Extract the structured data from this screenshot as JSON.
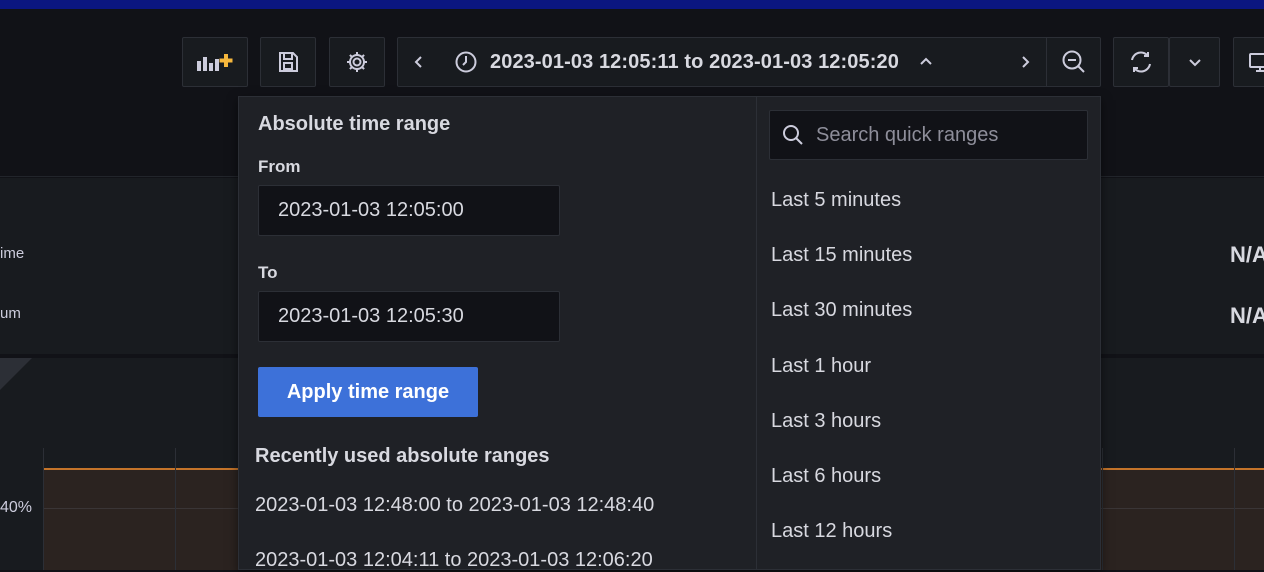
{
  "toolbar": {
    "time_range_text": "2023-01-03 12:05:11 to 2023-01-03 12:05:20",
    "icons": [
      "add-panel-icon",
      "save-icon",
      "gear-icon",
      "chevron-left-icon",
      "clock-icon",
      "chevron-up-icon",
      "chevron-right-icon",
      "zoom-out-icon",
      "refresh-icon",
      "chevron-down-icon",
      "tv-icon"
    ]
  },
  "background": {
    "row_labels": [
      "ime",
      "um"
    ],
    "values": [
      "N/A",
      "N/A"
    ],
    "axis_tick": "40%"
  },
  "picker": {
    "title": "Absolute time range",
    "from_label": "From",
    "from_value": "2023-01-03 12:05:00",
    "to_label": "To",
    "to_value": "2023-01-03 12:05:30",
    "apply_label": "Apply time range",
    "recent_title": "Recently used absolute ranges",
    "recent": [
      "2023-01-03 12:48:00 to 2023-01-03 12:48:40",
      "2023-01-03 12:04:11 to 2023-01-03 12:06:20"
    ],
    "search_placeholder": "Search quick ranges",
    "quick_ranges": [
      "Last 5 minutes",
      "Last 15 minutes",
      "Last 30 minutes",
      "Last 1 hour",
      "Last 3 hours",
      "Last 6 hours",
      "Last 12 hours"
    ]
  }
}
